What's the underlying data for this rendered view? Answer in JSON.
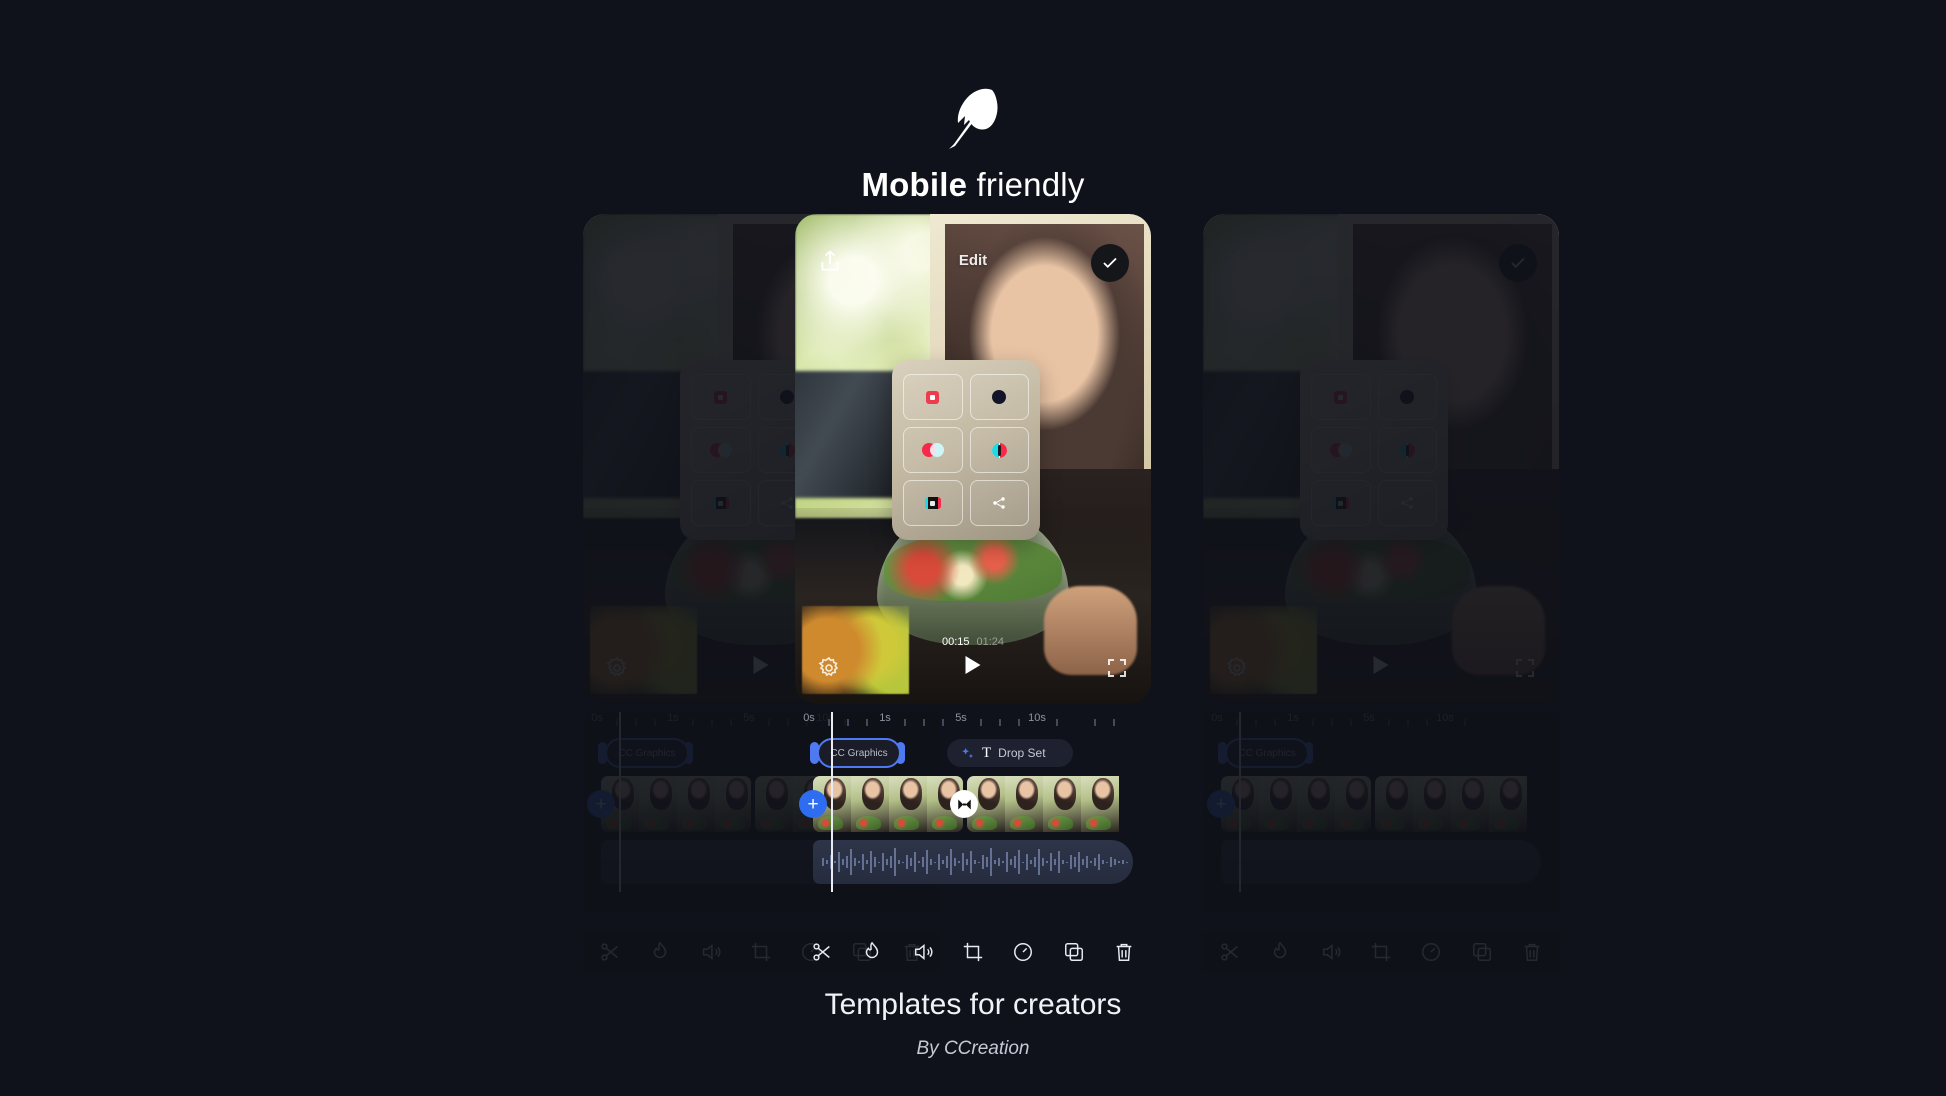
{
  "header": {
    "logo_icon": "feather-icon",
    "brand_bold": "Mobile",
    "brand_regular": " friendly"
  },
  "editor": {
    "topbar": {
      "share_icon": "share-icon",
      "title": "Edit",
      "confirm_icon": "check-icon"
    },
    "fx_panel": {
      "buttons": [
        {
          "icon": "record-square-icon"
        },
        {
          "icon": "black-dot-icon"
        },
        {
          "icon": "venn-circles-icon"
        },
        {
          "icon": "music-note-badge-icon"
        },
        {
          "icon": "glitch-frame-icon"
        },
        {
          "icon": "share-nodes-icon"
        }
      ]
    },
    "player": {
      "current_time": "00:15",
      "total_time": "01:24",
      "settings_icon": "gear-icon",
      "play_icon": "play-icon",
      "fullscreen_icon": "fullscreen-icon"
    },
    "timeline": {
      "ruler_labels": [
        "0s",
        "1s",
        "5s",
        "10s"
      ],
      "clips": [
        {
          "label": "CC Graphics",
          "selected": true
        },
        {
          "label": "Drop Set",
          "icon": "sparkle-icon",
          "type_glyph": "T",
          "selected": false
        }
      ],
      "add_button": "+",
      "add_button_name": "add-clip-button",
      "transition_icon": "transition-bowtie-icon",
      "accent_color": "#4f79f0"
    },
    "toolbar": [
      {
        "icon": "scissors-icon",
        "name": "split-button"
      },
      {
        "icon": "flame-icon",
        "name": "effects-button"
      },
      {
        "icon": "volume-icon",
        "name": "volume-button"
      },
      {
        "icon": "crop-icon",
        "name": "crop-button"
      },
      {
        "icon": "speed-gauge-icon",
        "name": "speed-button"
      },
      {
        "icon": "duplicate-icon",
        "name": "duplicate-button"
      },
      {
        "icon": "trash-icon",
        "name": "delete-button"
      }
    ]
  },
  "footer": {
    "title": "Templates for creators",
    "byline": "By CCreation"
  },
  "colors": {
    "background": "#0f121a",
    "accent_blue": "#4f79f0",
    "add_blue": "#2f6df0",
    "panel_beige": "#c2b8a2",
    "text_primary": "#f0f2f6",
    "text_muted": "#8d93a3"
  }
}
